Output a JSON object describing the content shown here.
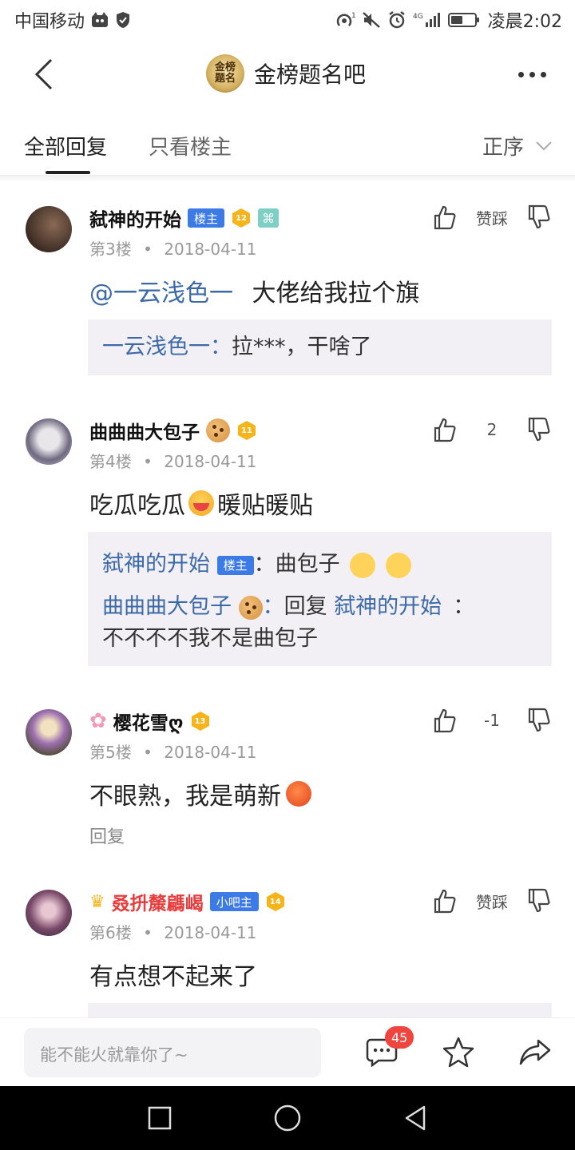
{
  "status_bar": {
    "carrier": "中国移动",
    "time": "凌晨2:02",
    "network": "4G"
  },
  "nav": {
    "forum_name": "金榜题名吧",
    "forum_logo_text": "金榜题名"
  },
  "tabs": {
    "all": "全部回复",
    "owner_only": "只看楼主",
    "sort": "正序"
  },
  "posts": [
    {
      "username": "弑神的开始",
      "role_tag": "楼主",
      "level": "12",
      "floor": "第3楼",
      "date": "2018-04-11",
      "like_label": "赞踩",
      "mention": "@一云浅色一",
      "content": "大佬给我拉个旗",
      "quotes": [
        {
          "name": "一云浅色一：",
          "text": "拉***，干啥了"
        }
      ]
    },
    {
      "username": "曲曲曲大包子",
      "level": "11",
      "floor": "第4楼",
      "date": "2018-04-11",
      "like_count": "2",
      "content_a": "吃瓜吃瓜",
      "content_b": "暖贴暖贴",
      "quotes": [
        {
          "name": "弑神的开始",
          "tag": "楼主",
          "sep": "：",
          "text": "曲包子"
        },
        {
          "name": "曲曲曲大包子",
          "sep": "：",
          "text_a": "回复",
          "target": "弑神的开始",
          "text_b": "：",
          "text_c": "不不不不我不是曲包子"
        }
      ]
    },
    {
      "username": "樱花雪ღ",
      "level": "13",
      "floor": "第5楼",
      "date": "2018-04-11",
      "like_count": "-1",
      "content": "不眼熟，我是萌新",
      "reply_label": "回复"
    },
    {
      "username": "叒抍斄騗嵑",
      "role_tag": "小吧主",
      "level": "14",
      "floor": "第6楼",
      "date": "2018-04-11",
      "like_label": "赞踩",
      "content": "有点想不起来了"
    }
  ],
  "meta_separator": "•",
  "bottom_bar": {
    "input_placeholder": "能不能火就靠你了~",
    "message_count": "45"
  },
  "colors": {
    "accent_blue": "#3c7be6",
    "mention_blue": "#3c6aa8",
    "badge_red": "#f0443e",
    "level_gold": "#f4b41a",
    "quote_bg": "#f2f0f4"
  }
}
